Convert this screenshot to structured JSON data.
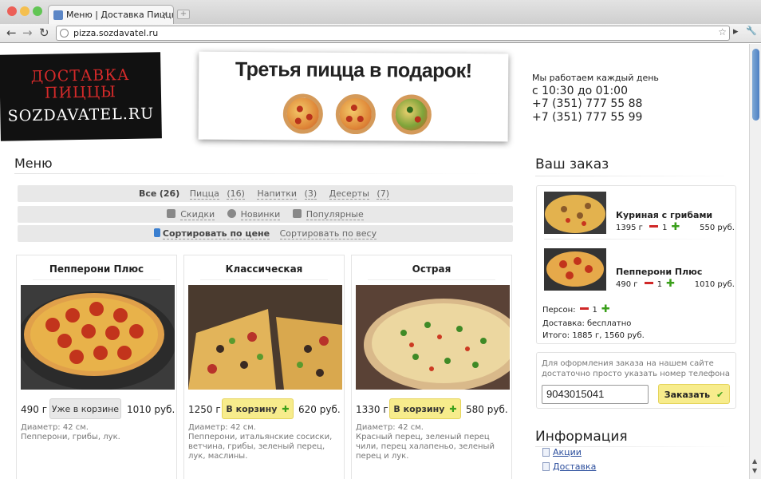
{
  "browser": {
    "tab_title": "Меню | Доставка Пиццы",
    "tab_close": "×",
    "new_tab": "+",
    "url": "pizza.sozdavatel.ru",
    "back": "←",
    "forward": "→",
    "reload": "↻",
    "bookmark": "☆",
    "page_icon": "▸",
    "wrench": "🔧"
  },
  "header": {
    "logo_line1": "ДОСТАВКА",
    "logo_line2": "ПИЦЦЫ",
    "logo_line3": "SOZDAVATEL.RU",
    "promo_text": "Третья пицца в подарок!",
    "hours_label": "Мы работаем каждый день",
    "hours_value": "с 10:30 до 01:00",
    "phone1": "+7 (351) 777 55 88",
    "phone2": "+7 (351) 777 55 99"
  },
  "menu": {
    "title": "Меню",
    "categories": [
      {
        "label": "Все",
        "count": "(26)"
      },
      {
        "label": "Пицца",
        "count": "(16)"
      },
      {
        "label": "Напитки",
        "count": "(3)"
      },
      {
        "label": "Десерты",
        "count": "(7)"
      }
    ],
    "tags": [
      "Скидки",
      "Новинки",
      "Популярные"
    ],
    "sort": [
      "Сортировать по цене",
      "Сортировать по весу"
    ],
    "products": [
      {
        "name": "Пепперони Плюс",
        "weight": "490 г",
        "button": "Уже в корзине",
        "price": "1010 руб.",
        "in_cart": true,
        "desc": "Диаметр: 42 см.\nПепперони, грибы, лук."
      },
      {
        "name": "Классическая",
        "weight": "1250 г",
        "button": "В корзину",
        "price": "620 руб.",
        "in_cart": false,
        "desc": "Диаметр: 42 см.\nПепперони, итальянские сосиски, ветчина, грибы, зеленый перец, лук, маслины."
      },
      {
        "name": "Острая",
        "weight": "1330 г",
        "button": "В корзину",
        "price": "580 руб.",
        "in_cart": false,
        "desc": "Диаметр: 42 см.\nКрасный перец, зеленый перец чили, перец халапеньо, зеленый перец и лук."
      }
    ]
  },
  "order": {
    "title": "Ваш заказ",
    "items": [
      {
        "name": "Куриная с грибами",
        "weight": "1395 г",
        "qty": "1",
        "price": "550 руб."
      },
      {
        "name": "Пепперони Плюс",
        "weight": "490 г",
        "qty": "1",
        "price": "1010 руб."
      }
    ],
    "persons_label": "Персон:",
    "persons_qty": "1",
    "delivery": "Доставка: бесплатно",
    "total": "Итого: 1885 г, 1560 руб.",
    "note": "Для оформления заказа на нашем сайте достаточно просто указать номер телефона",
    "phone_value": "9043015041",
    "submit": "Заказать",
    "check": "✔"
  },
  "info": {
    "title": "Информация",
    "links": [
      "Акции",
      "Доставка"
    ]
  },
  "plus_sign": "✚",
  "colors": {
    "accent_yellow": "#f7ec8c",
    "plus_green": "#3a9f1a",
    "minus_red": "#d02828",
    "logo_red": "#d52a2a"
  }
}
